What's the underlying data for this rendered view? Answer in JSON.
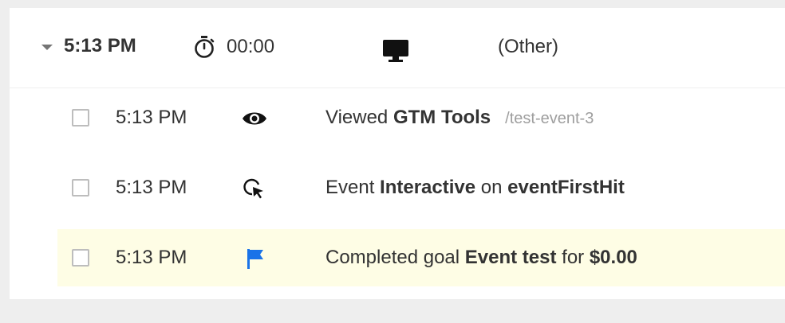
{
  "session": {
    "time": "5:13 PM",
    "duration": "00:00",
    "device_icon": "desktop-icon",
    "source": "(Other)"
  },
  "events": [
    {
      "time": "5:13 PM",
      "icon": "eye-icon",
      "prefix": "Viewed ",
      "bold1": "GTM Tools",
      "mid": "",
      "bold2": "",
      "path": "/test-event-3",
      "highlighted": false
    },
    {
      "time": "5:13 PM",
      "icon": "cursor-click-icon",
      "prefix": "Event ",
      "bold1": "Interactive",
      "mid": " on ",
      "bold2": "eventFirstHit",
      "path": "",
      "highlighted": false
    },
    {
      "time": "5:13 PM",
      "icon": "flag-icon",
      "prefix": "Completed goal ",
      "bold1": "Event test",
      "mid": " for ",
      "bold2": "$0.00",
      "path": "",
      "highlighted": true
    }
  ],
  "colors": {
    "goal_highlight": "#fefde5",
    "flag": "#1a73e8"
  }
}
